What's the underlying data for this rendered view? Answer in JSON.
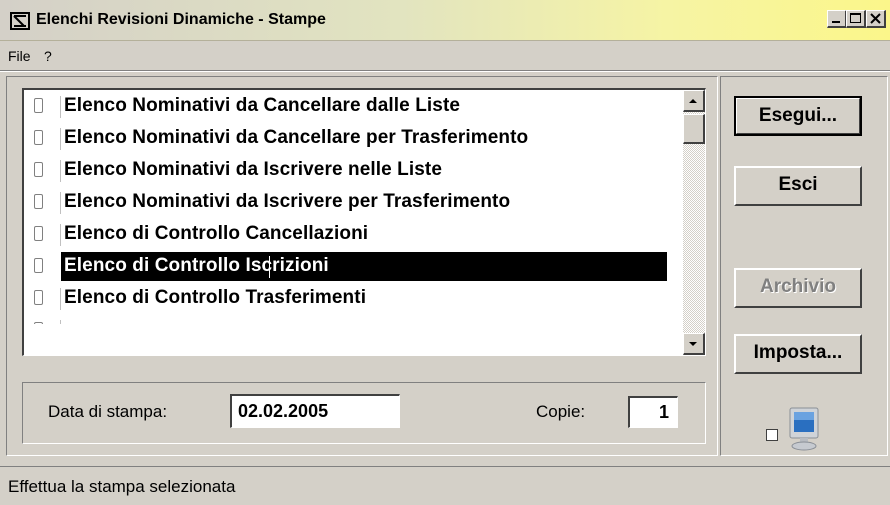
{
  "window": {
    "title": "Elenchi Revisioni Dinamiche - Stampe"
  },
  "menu": {
    "items": [
      {
        "label": "File"
      },
      {
        "label": "?"
      }
    ]
  },
  "list": {
    "items": [
      {
        "label": "Elenco Nominativi da Cancellare dalle Liste",
        "checked": false,
        "selected": false
      },
      {
        "label": "Elenco Nominativi da Cancellare per Trasferimento",
        "checked": false,
        "selected": false
      },
      {
        "label": "Elenco Nominativi da Iscrivere nelle Liste",
        "checked": false,
        "selected": false
      },
      {
        "label": "Elenco Nominativi da Iscrivere per Trasferimento",
        "checked": false,
        "selected": false
      },
      {
        "label": "Elenco di Controllo Cancellazioni",
        "checked": false,
        "selected": false
      },
      {
        "label": "Elenco di Controllo Iscrizioni",
        "checked": false,
        "selected": true
      },
      {
        "label": "Elenco di Controllo Trasferimenti",
        "checked": false,
        "selected": false
      }
    ]
  },
  "form": {
    "date_label": "Data di stampa:",
    "date_value": "02.02.2005",
    "copies_label": "Copie:",
    "copies_value": "1"
  },
  "buttons": {
    "esegui": "Esegui...",
    "esci": "Esci",
    "archivio": "Archivio",
    "imposta": "Imposta..."
  },
  "status": {
    "text": "Effettua la stampa selezionata"
  },
  "icons": {
    "app": "app-logo-icon",
    "minimize": "minimize-icon",
    "maximize": "maximize-icon",
    "close": "close-icon",
    "monitor": "monitor-icon"
  }
}
